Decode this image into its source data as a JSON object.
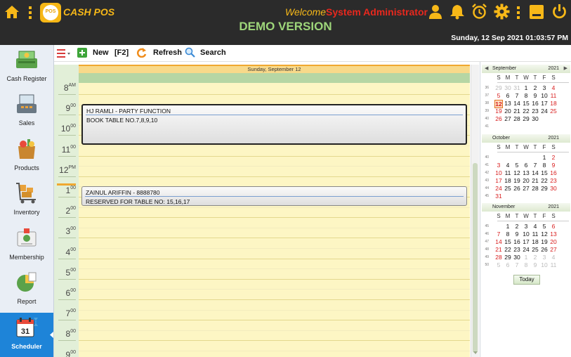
{
  "header": {
    "app_name": "CASH POS",
    "logo_text": "POS",
    "banner": "DEMO VERSION",
    "welcome_label": "Welcome",
    "user_name": "System Administrator",
    "datetime": "Sunday, 12 Sep 2021 01:03:57 PM",
    "icons": [
      "home-icon",
      "vertical-dots-icon",
      "user-icon",
      "bell-icon",
      "alarm-clock-icon",
      "gear-icon",
      "vertical-dots-icon",
      "minimize-icon",
      "power-icon"
    ],
    "accent_color": "#f7b818"
  },
  "sidebar": {
    "items": [
      {
        "label": "Cash Register",
        "icon": "cash-register-icon",
        "active": false
      },
      {
        "label": "Sales",
        "icon": "sales-terminal-icon",
        "active": false
      },
      {
        "label": "Products",
        "icon": "grocery-bag-icon",
        "active": false
      },
      {
        "label": "Inventory",
        "icon": "inventory-cart-icon",
        "active": false
      },
      {
        "label": "Membership",
        "icon": "membership-card-icon",
        "active": false
      },
      {
        "label": "Report",
        "icon": "report-icon",
        "active": false
      },
      {
        "label": "Scheduler",
        "icon": "calendar-icon",
        "active": true
      }
    ]
  },
  "toolbar": {
    "new_label": "New",
    "new_shortcut": "[F2]",
    "refresh_label": "Refresh",
    "search_label": "Search"
  },
  "day_view": {
    "date_header": "Sunday, September 12",
    "hours": [
      {
        "h": "8",
        "s": "AM"
      },
      {
        "h": "9",
        "s": "00"
      },
      {
        "h": "10",
        "s": "00"
      },
      {
        "h": "11",
        "s": "00"
      },
      {
        "h": "12",
        "s": "PM"
      },
      {
        "h": "1",
        "s": "00"
      },
      {
        "h": "2",
        "s": "00"
      },
      {
        "h": "3",
        "s": "00"
      },
      {
        "h": "4",
        "s": "00"
      },
      {
        "h": "5",
        "s": "00"
      },
      {
        "h": "6",
        "s": "00"
      },
      {
        "h": "7",
        "s": "00"
      },
      {
        "h": "8",
        "s": "00"
      },
      {
        "h": "9",
        "s": "00"
      }
    ],
    "appointments": [
      {
        "subject": "HJ RAMLI - PARTY FUNCTION",
        "detail": "BOOK TABLE NO.7,8,9,10",
        "start": "9:00 AM",
        "end": "11:00 AM"
      },
      {
        "subject": "ZAINUL ARIFFIN - 8888780",
        "detail": "RESERVED FOR TABLE NO: 15,16,17",
        "start": "1:00 PM",
        "end": "2:00 PM"
      }
    ]
  },
  "mini_calendar": {
    "day_names": [
      "S",
      "M",
      "T",
      "W",
      "T",
      "F",
      "S"
    ],
    "today_label": "Today",
    "months": [
      {
        "name": "September",
        "year": "2021",
        "show_nav": true,
        "weeks": [
          {
            "wk": "36",
            "days": [
              [
                "29",
                "oth"
              ],
              [
                "30",
                "oth"
              ],
              [
                "31",
                "oth"
              ],
              [
                "1",
                ""
              ],
              [
                "2",
                ""
              ],
              [
                "3",
                ""
              ],
              [
                "4",
                "we"
              ]
            ]
          },
          {
            "wk": "37",
            "days": [
              [
                "5",
                "we"
              ],
              [
                "6",
                ""
              ],
              [
                "7",
                ""
              ],
              [
                "8",
                ""
              ],
              [
                "9",
                ""
              ],
              [
                "10",
                ""
              ],
              [
                "11",
                "we"
              ]
            ]
          },
          {
            "wk": "38",
            "days": [
              [
                "12",
                "we today"
              ],
              [
                "13",
                ""
              ],
              [
                "14",
                ""
              ],
              [
                "15",
                ""
              ],
              [
                "16",
                ""
              ],
              [
                "17",
                ""
              ],
              [
                "18",
                "we"
              ]
            ]
          },
          {
            "wk": "39",
            "days": [
              [
                "19",
                "we"
              ],
              [
                "20",
                ""
              ],
              [
                "21",
                ""
              ],
              [
                "22",
                ""
              ],
              [
                "23",
                ""
              ],
              [
                "24",
                ""
              ],
              [
                "25",
                "we"
              ]
            ]
          },
          {
            "wk": "40",
            "days": [
              [
                "26",
                "we"
              ],
              [
                "27",
                ""
              ],
              [
                "28",
                ""
              ],
              [
                "29",
                ""
              ],
              [
                "30",
                ""
              ],
              [
                "",
                ""
              ],
              [
                "",
                ""
              ]
            ]
          },
          {
            "wk": "41",
            "days": [
              [
                "",
                ""
              ],
              [
                "",
                ""
              ],
              [
                "",
                ""
              ],
              [
                "",
                ""
              ],
              [
                "",
                ""
              ],
              [
                "",
                ""
              ],
              [
                "",
                ""
              ]
            ]
          }
        ]
      },
      {
        "name": "October",
        "year": "2021",
        "show_nav": false,
        "weeks": [
          {
            "wk": "40",
            "days": [
              [
                "",
                ""
              ],
              [
                "",
                ""
              ],
              [
                "",
                ""
              ],
              [
                "",
                ""
              ],
              [
                "",
                ""
              ],
              [
                "1",
                ""
              ],
              [
                "2",
                "we"
              ]
            ]
          },
          {
            "wk": "41",
            "days": [
              [
                "3",
                "we"
              ],
              [
                "4",
                ""
              ],
              [
                "5",
                ""
              ],
              [
                "6",
                ""
              ],
              [
                "7",
                ""
              ],
              [
                "8",
                ""
              ],
              [
                "9",
                "we"
              ]
            ]
          },
          {
            "wk": "42",
            "days": [
              [
                "10",
                "we"
              ],
              [
                "11",
                ""
              ],
              [
                "12",
                ""
              ],
              [
                "13",
                ""
              ],
              [
                "14",
                ""
              ],
              [
                "15",
                ""
              ],
              [
                "16",
                "we"
              ]
            ]
          },
          {
            "wk": "43",
            "days": [
              [
                "17",
                "we"
              ],
              [
                "18",
                ""
              ],
              [
                "19",
                ""
              ],
              [
                "20",
                ""
              ],
              [
                "21",
                ""
              ],
              [
                "22",
                ""
              ],
              [
                "23",
                "we"
              ]
            ]
          },
          {
            "wk": "44",
            "days": [
              [
                "24",
                "we"
              ],
              [
                "25",
                ""
              ],
              [
                "26",
                ""
              ],
              [
                "27",
                ""
              ],
              [
                "28",
                ""
              ],
              [
                "29",
                ""
              ],
              [
                "30",
                "we"
              ]
            ]
          },
          {
            "wk": "45",
            "days": [
              [
                "31",
                "we"
              ],
              [
                "",
                ""
              ],
              [
                "",
                ""
              ],
              [
                "",
                ""
              ],
              [
                "",
                ""
              ],
              [
                "",
                ""
              ],
              [
                "",
                ""
              ]
            ]
          }
        ]
      },
      {
        "name": "November",
        "year": "2021",
        "show_nav": false,
        "weeks": [
          {
            "wk": "45",
            "days": [
              [
                "",
                ""
              ],
              [
                "1",
                ""
              ],
              [
                "2",
                ""
              ],
              [
                "3",
                ""
              ],
              [
                "4",
                ""
              ],
              [
                "5",
                ""
              ],
              [
                "6",
                "we"
              ]
            ]
          },
          {
            "wk": "46",
            "days": [
              [
                "7",
                "we"
              ],
              [
                "8",
                ""
              ],
              [
                "9",
                ""
              ],
              [
                "10",
                ""
              ],
              [
                "11",
                ""
              ],
              [
                "12",
                ""
              ],
              [
                "13",
                "we"
              ]
            ]
          },
          {
            "wk": "47",
            "days": [
              [
                "14",
                "we"
              ],
              [
                "15",
                ""
              ],
              [
                "16",
                ""
              ],
              [
                "17",
                ""
              ],
              [
                "18",
                ""
              ],
              [
                "19",
                ""
              ],
              [
                "20",
                "we"
              ]
            ]
          },
          {
            "wk": "48",
            "days": [
              [
                "21",
                "we"
              ],
              [
                "22",
                ""
              ],
              [
                "23",
                ""
              ],
              [
                "24",
                ""
              ],
              [
                "25",
                ""
              ],
              [
                "26",
                ""
              ],
              [
                "27",
                "we"
              ]
            ]
          },
          {
            "wk": "49",
            "days": [
              [
                "28",
                "we"
              ],
              [
                "29",
                ""
              ],
              [
                "30",
                ""
              ],
              [
                "1",
                "oth"
              ],
              [
                "2",
                "oth"
              ],
              [
                "3",
                "oth"
              ],
              [
                "4",
                "oth"
              ]
            ]
          },
          {
            "wk": "50",
            "days": [
              [
                "5",
                "oth"
              ],
              [
                "6",
                "oth"
              ],
              [
                "7",
                "oth"
              ],
              [
                "8",
                "oth"
              ],
              [
                "9",
                "oth"
              ],
              [
                "10",
                "oth"
              ],
              [
                "11",
                "oth"
              ]
            ]
          }
        ]
      }
    ]
  }
}
